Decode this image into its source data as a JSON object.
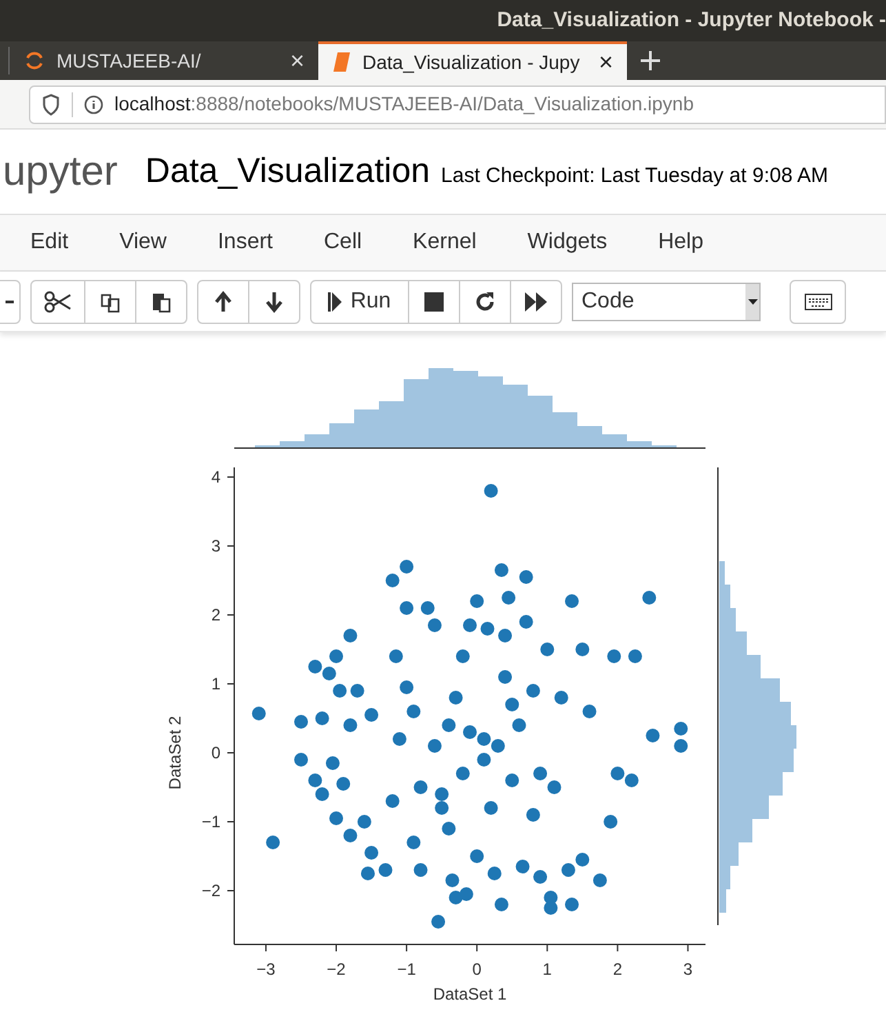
{
  "window": {
    "title": "Data_Visualization - Jupyter Notebook -"
  },
  "tabs": [
    {
      "label": "MUSTAJEEB-AI/",
      "selected": false,
      "close": "×"
    },
    {
      "label": "Data_Visualization - Jupy",
      "selected": true,
      "close": "×"
    }
  ],
  "address_bar": {
    "host": "localhost",
    "path": ":8888/notebooks/MUSTAJEEB-AI/Data_Visualization.ipynb"
  },
  "header": {
    "logo_text": "upyter",
    "notebook_name": "Data_Visualization",
    "checkpoint": "Last Checkpoint: Last Tuesday at 9:08 AM"
  },
  "menu": [
    "Edit",
    "View",
    "Insert",
    "Cell",
    "Kernel",
    "Widgets",
    "Help"
  ],
  "toolbar": {
    "run_label": "Run",
    "cell_type": "Code"
  },
  "output": {
    "chart_data": {
      "type": "scatter",
      "xlabel": "DataSet 1",
      "ylabel": "DataSet 2",
      "x": [
        -3.1,
        -2.9,
        -2.5,
        -2.5,
        -2.3,
        -2.3,
        -2.2,
        -2.2,
        -2.1,
        -2.05,
        -2.0,
        -2.0,
        -1.95,
        -1.9,
        -1.8,
        -1.8,
        -1.8,
        -1.7,
        -1.6,
        -1.55,
        -1.5,
        -1.5,
        -1.3,
        -1.2,
        -1.15,
        -1.0,
        -1.0,
        -1.0,
        -0.9,
        -0.8,
        -0.7,
        -0.6,
        -0.55,
        -0.5,
        -0.4,
        -0.35,
        -0.3,
        -0.2,
        -0.15,
        -0.1,
        0,
        0,
        0.1,
        0.15,
        0.2,
        0.25,
        0.35,
        0.35,
        0.4,
        0.45,
        0.5,
        0.65,
        0.7,
        0.7,
        0.8,
        0.9,
        1.05,
        1.05,
        1.0,
        1.35,
        1.35,
        1.3,
        1.5,
        1.5,
        1.75,
        1.95,
        2.25,
        2.45,
        2.5,
        2.9,
        2.9,
        2.2,
        2.0,
        1.9,
        0.3,
        -0.2,
        0.6,
        -0.6,
        0.2,
        1.2,
        -1.2,
        0.9,
        -0.3,
        1.6,
        -0.8,
        0.1,
        -0.1,
        0.5,
        -0.5,
        0.8,
        -0.9,
        1.1,
        -1.1,
        0.4,
        -0.4
      ],
      "values": [
        0.57,
        -1.3,
        0.45,
        -0.1,
        1.25,
        -0.4,
        0.5,
        -0.6,
        1.15,
        -0.15,
        1.4,
        -0.95,
        0.9,
        -0.45,
        1.7,
        0.4,
        -1.2,
        0.9,
        -1.0,
        -1.75,
        0.55,
        -1.45,
        -1.7,
        2.5,
        1.4,
        2.7,
        2.1,
        0.95,
        -1.3,
        -1.7,
        2.1,
        1.85,
        -2.45,
        -0.8,
        0.4,
        -1.85,
        -2.1,
        1.4,
        -2.05,
        1.85,
        2.2,
        -1.5,
        0.2,
        1.8,
        3.8,
        -1.75,
        2.65,
        -2.2,
        1.7,
        2.25,
        -0.4,
        -1.65,
        2.55,
        1.9,
        0.9,
        -1.8,
        -2.25,
        -2.1,
        1.5,
        2.2,
        -2.2,
        -1.7,
        1.5,
        -1.55,
        -1.85,
        1.4,
        1.4,
        2.25,
        0.25,
        0.35,
        0.1,
        -0.4,
        -0.3,
        -1.0,
        0.1,
        -0.3,
        0.4,
        0.1,
        -0.8,
        0.8,
        -0.7,
        -0.3,
        0.8,
        0.6,
        -0.5,
        -0.1,
        0.3,
        0.7,
        -0.6,
        -0.9,
        0.6,
        -0.5,
        0.2,
        1.1,
        -1.1
      ],
      "xticks": [
        {
          "value": -3,
          "label": "−3"
        },
        {
          "value": -2,
          "label": "−2"
        },
        {
          "value": -1,
          "label": "−1"
        },
        0,
        1,
        2,
        3
      ],
      "xlim": [
        -3.45,
        3.25
      ],
      "ylim": [
        -2.78,
        4.12
      ],
      "yticks": [
        {
          "value": -2,
          "label": "−2"
        },
        {
          "value": -1,
          "label": "−1"
        },
        0,
        1,
        2,
        3,
        4
      ]
    }
  }
}
